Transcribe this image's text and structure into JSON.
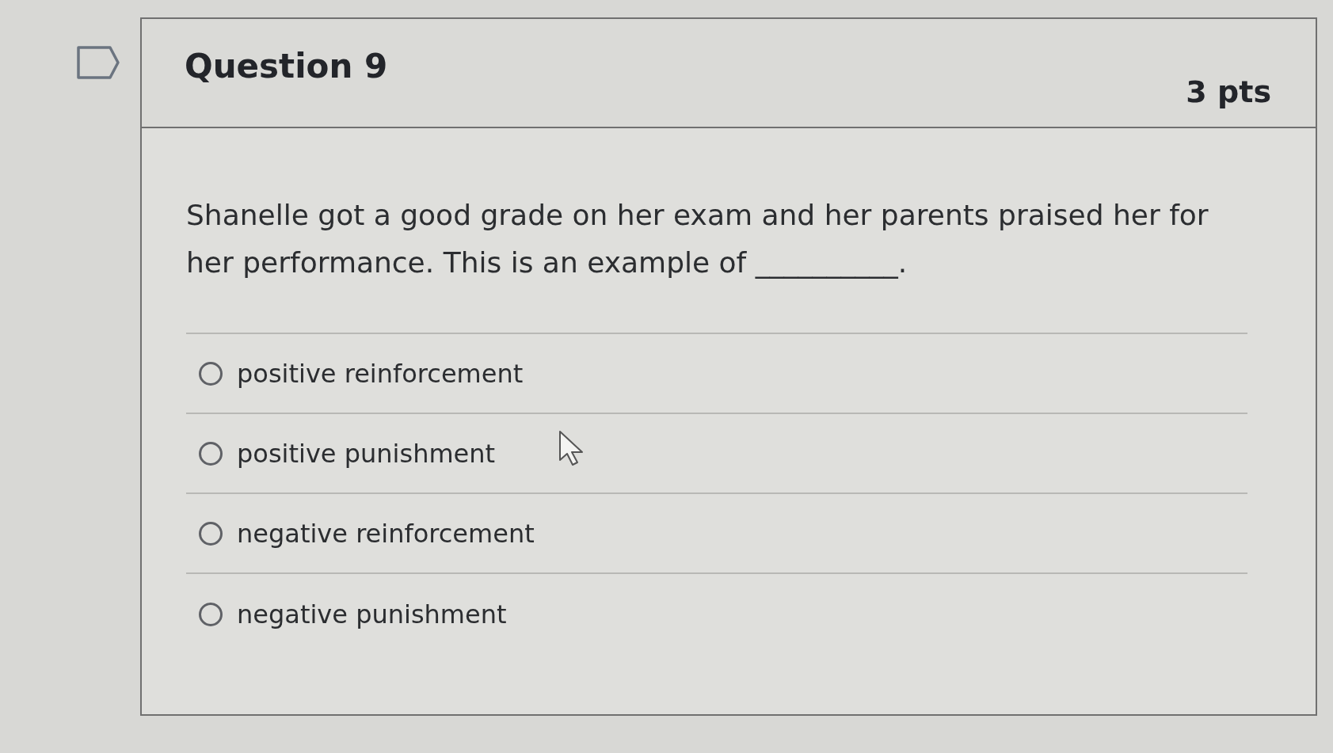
{
  "question": {
    "title": "Question 9",
    "points": "3 pts"
  },
  "prompt": "Shanelle got a good grade on her exam and her parents praised her for her performance. This is an example of __________.",
  "options": [
    {
      "label": "positive reinforcement",
      "selected": false
    },
    {
      "label": "positive punishment",
      "selected": false
    },
    {
      "label": "negative reinforcement",
      "selected": false
    },
    {
      "label": "negative punishment",
      "selected": false
    }
  ]
}
